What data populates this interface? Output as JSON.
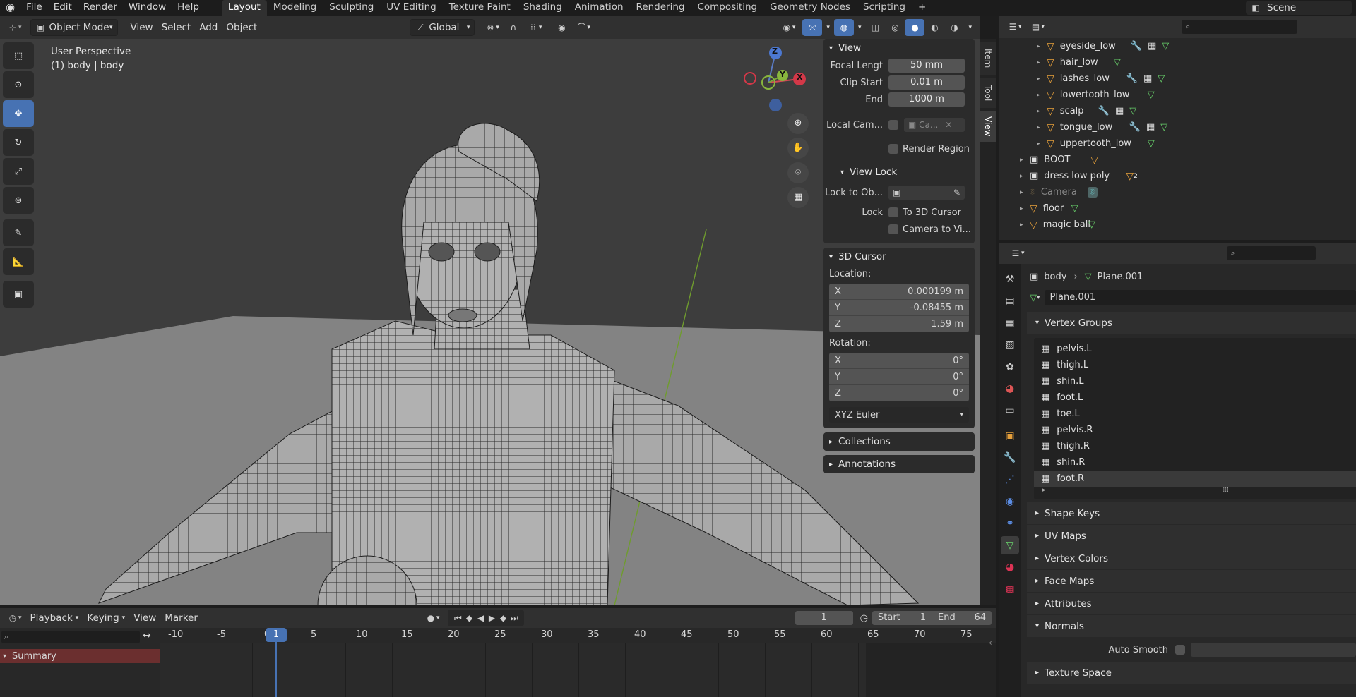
{
  "topbar": {
    "menus": [
      "File",
      "Edit",
      "Render",
      "Window",
      "Help"
    ],
    "workspaces": [
      "Layout",
      "Modeling",
      "Sculpting",
      "UV Editing",
      "Texture Paint",
      "Shading",
      "Animation",
      "Rendering",
      "Compositing",
      "Geometry Nodes",
      "Scripting"
    ],
    "active_workspace": "Layout",
    "add_tab": "+",
    "scene": "Scene"
  },
  "viewport_header": {
    "mode": "Object Mode",
    "menus": [
      "View",
      "Select",
      "Add",
      "Object"
    ],
    "orientation": "Global"
  },
  "viewport": {
    "perspective": "User Perspective",
    "active_object": "(1) body | body",
    "gizmo": {
      "z": "Z",
      "y": "Y",
      "x": "X"
    }
  },
  "npanel": {
    "tabs": [
      "Item",
      "Tool",
      "View"
    ],
    "view": {
      "title": "View",
      "focal_label": "Focal Lengt",
      "focal_value": "50 mm",
      "clip_start_label": "Clip Start",
      "clip_start_value": "0.01 m",
      "end_label": "End",
      "end_value": "1000 m",
      "local_cam_label": "Local Cam...",
      "local_cam_value": "Ca...",
      "render_region": "Render Region",
      "view_lock_title": "View Lock",
      "lock_to_obj_label": "Lock to Ob...",
      "lock_label": "Lock",
      "to_3d_cursor": "To 3D Cursor",
      "camera_to_view": "Camera to Vi..."
    },
    "cursor": {
      "title": "3D Cursor",
      "location_label": "Location:",
      "x": "0.000199 m",
      "y": "-0.08455 m",
      "z": "1.59 m",
      "rotation_label": "Rotation:",
      "rx": "0°",
      "ry": "0°",
      "rz": "0°",
      "mode": "XYZ Euler"
    },
    "collections": "Collections",
    "annotations": "Annotations"
  },
  "axis_labels": {
    "x": "X",
    "y": "Y",
    "z": "Z"
  },
  "outliner": {
    "children": [
      {
        "name": "eyeside_low",
        "mods": true
      },
      {
        "name": "hair_low",
        "mods": false
      },
      {
        "name": "lashes_low",
        "mods": true
      },
      {
        "name": "lowertooth_low",
        "mods": false
      },
      {
        "name": "scalp",
        "mods": true
      },
      {
        "name": "tongue_low",
        "mods": true
      },
      {
        "name": "uppertooth_low",
        "mods": false
      }
    ],
    "roots": [
      "BOOT",
      "dress low poly",
      "Camera",
      "floor",
      "magic ball"
    ],
    "badge_2": "2"
  },
  "properties": {
    "breadcrumb_obj": "body",
    "breadcrumb_mesh": "Plane.001",
    "mesh_name": "Plane.001",
    "vertex_groups_title": "Vertex Groups",
    "vertex_groups": [
      "pelvis.L",
      "thigh.L",
      "shin.L",
      "foot.L",
      "toe.L",
      "pelvis.R",
      "thigh.R",
      "shin.R",
      "foot.R"
    ],
    "sections": [
      "Shape Keys",
      "UV Maps",
      "Vertex Colors",
      "Face Maps",
      "Attributes"
    ],
    "normals": "Normals",
    "auto_smooth": "Auto Smooth",
    "texture_space": "Texture Space"
  },
  "timeline": {
    "menus": [
      "Playback",
      "Keying",
      "View",
      "Marker"
    ],
    "current_frame": "1",
    "start_label": "Start",
    "start_value": "1",
    "end_label": "End",
    "end_value": "64",
    "ticks": [
      "-10",
      "-5",
      "0",
      "5",
      "10",
      "15",
      "20",
      "25",
      "30",
      "35",
      "40",
      "45",
      "50",
      "55",
      "60",
      "65",
      "70",
      "75"
    ],
    "summary": "Summary",
    "playhead": "1"
  }
}
